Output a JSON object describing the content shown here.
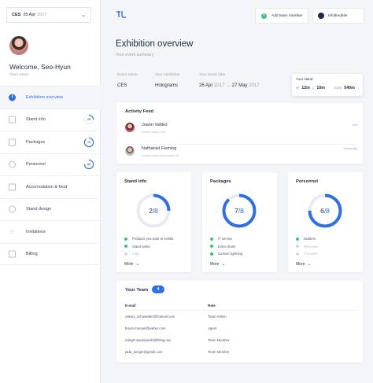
{
  "event_select": {
    "code": "CES",
    "date": "25 Apr",
    "year": "2017"
  },
  "profile": {
    "welcome": "Welcome, Seo-Hyun",
    "role": "Team Admin"
  },
  "nav": [
    {
      "label": "Exhibition overview",
      "icon": "info-icon",
      "active": true
    },
    {
      "label": "Stand info",
      "icon": "edit-icon",
      "progress": 0.25,
      "progress_label": "2/8"
    },
    {
      "label": "Packages",
      "icon": "folder-icon",
      "progress": 0.88,
      "progress_label": "7/8"
    },
    {
      "label": "Personnel",
      "icon": "people-icon",
      "progress": 0.75,
      "progress_label": "6/8"
    },
    {
      "label": "Accomodation & food",
      "icon": "pencil-icon"
    },
    {
      "label": "Stand design",
      "icon": "design-icon"
    },
    {
      "label": "Invitations",
      "icon": "star-icon"
    },
    {
      "label": "Billing",
      "icon": "document-icon"
    }
  ],
  "topbar": {
    "add_label": "Add team member",
    "user_label": "Infullmobile"
  },
  "header": {
    "title": "Exhibition overview",
    "subtitle": "Your event summary"
  },
  "summary": {
    "event_name_label": "Event name",
    "event_name": "CES",
    "exhibition_label": "Your exhibition",
    "exhibition": "Holograms",
    "date_label": "Your event date",
    "date_start": "26 Apr",
    "date_start_year": "2017",
    "date_arrow": "→",
    "date_end": "27 May",
    "date_end_year": "2017",
    "stand_label": "Your stand",
    "w_k": "W",
    "w_v": "12m",
    "l_k": "L",
    "l_v": "10m",
    "sqm_k": "SQM",
    "sqm_v": "540m"
  },
  "activity": {
    "title": "Activity Feed",
    "items": [
      {
        "name": "Joann Valdez",
        "desc": "Added stand info",
        "time": "13h"
      },
      {
        "name": "Nathaniel Fleming",
        "desc": "Added stand personnel (2)",
        "time": "Yesterday"
      }
    ]
  },
  "cards": [
    {
      "title": "Stand info",
      "num": "2",
      "den": "/8",
      "fraction": 0.25,
      "items": [
        {
          "text": "Products you want to exhibit",
          "on": true
        },
        {
          "text": "Stand name",
          "on": true
        },
        {
          "text": "Logo",
          "on": false
        }
      ],
      "more": "More"
    },
    {
      "title": "Packages",
      "num": "7",
      "den": "/8",
      "fraction": 0.88,
      "items": [
        {
          "text": "IT service",
          "on": true
        },
        {
          "text": "Extra chairs",
          "on": true
        },
        {
          "text": "Custom lightning",
          "on": true
        }
      ],
      "more": "More"
    },
    {
      "title": "Personnel",
      "num": "6",
      "den": "/8",
      "fraction": 0.75,
      "items": [
        {
          "text": "Builders",
          "on": true
        },
        {
          "text": "Executive",
          "on": false
        },
        {
          "text": "Transport",
          "on": false
        }
      ],
      "more": "More"
    }
  ],
  "team": {
    "title": "Your Team",
    "count": "4",
    "email_header": "E-mail",
    "role_header": "Role",
    "rows": [
      {
        "email": "zakary_schowalter@hotmail.com",
        "role": "Team Admin"
      },
      {
        "email": "braun.manuel@weber.com",
        "role": "Agent"
      },
      {
        "email": "raleigh.swaniawski@lbling.org",
        "role": "Team Member"
      },
      {
        "email": "jada_senger@gmail.com",
        "role": "Team Member"
      }
    ]
  },
  "colors": {
    "accent": "#2f6fe4",
    "done": "#3ac47d",
    "off": "#d3d8e0"
  }
}
